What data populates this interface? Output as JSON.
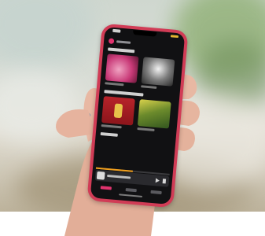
{
  "scene": {
    "description_label": "",
    "colors": {
      "foliage": "#93b27a",
      "sky": "#cfd7cf",
      "ground": "#a4977b",
      "skin": "#e8b8a3",
      "phone_case": "#d13c56"
    }
  },
  "app": {
    "accent": "#e0336e",
    "tabs": [
      {
        "icon": "home-icon",
        "active": true
      },
      {
        "icon": "library-icon",
        "active": false
      },
      {
        "icon": "search-icon",
        "active": false
      }
    ],
    "tiles": [
      {
        "name": "album-pink",
        "color": "#c93a78"
      },
      {
        "name": "album-bw",
        "color": "#7d7d7d"
      },
      {
        "name": "album-red",
        "color": "#b7232a"
      },
      {
        "name": "album-green",
        "color": "#6c8b2c"
      }
    ],
    "mini_player": {
      "progress": 0.5,
      "progress_color": "#f2a01d"
    }
  }
}
